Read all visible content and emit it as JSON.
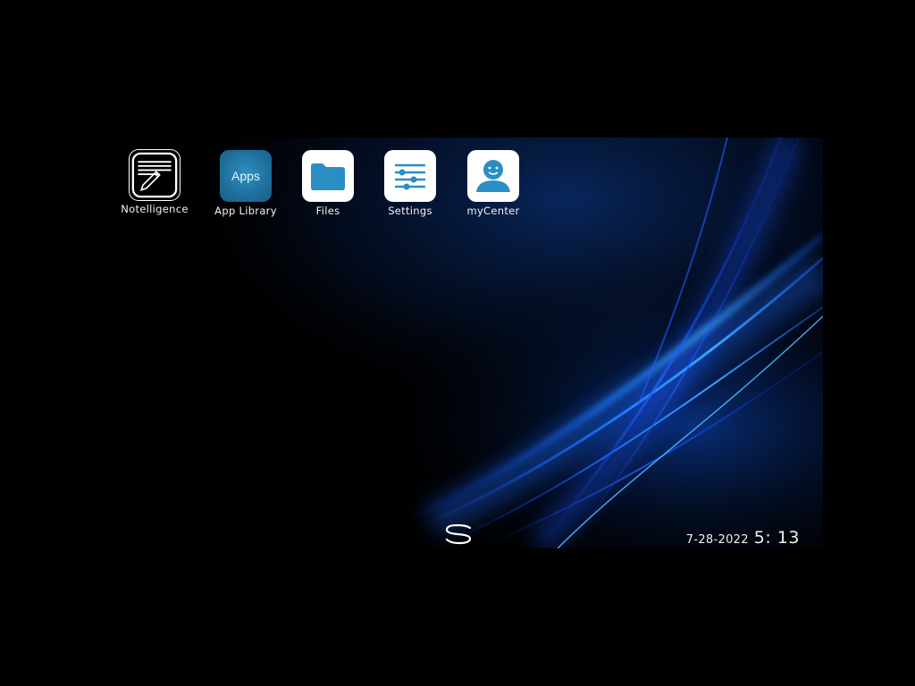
{
  "desktop": {
    "apps": [
      {
        "label": "Notelligence",
        "icon": "note-pencil-icon"
      },
      {
        "label": "App Library",
        "icon": "apps-grid-icon",
        "tile_text": "Apps"
      },
      {
        "label": "Files",
        "icon": "folder-icon"
      },
      {
        "label": "Settings",
        "icon": "sliders-icon"
      },
      {
        "label": "myCenter",
        "icon": "person-smile-icon"
      }
    ],
    "brand_mark": "S"
  },
  "status": {
    "date": "7-28-2022",
    "time": "5: 13"
  },
  "colors": {
    "background": "#000000",
    "accent_blue": "#2f8fc0",
    "wallpaper_glow": "#1e6bff"
  }
}
